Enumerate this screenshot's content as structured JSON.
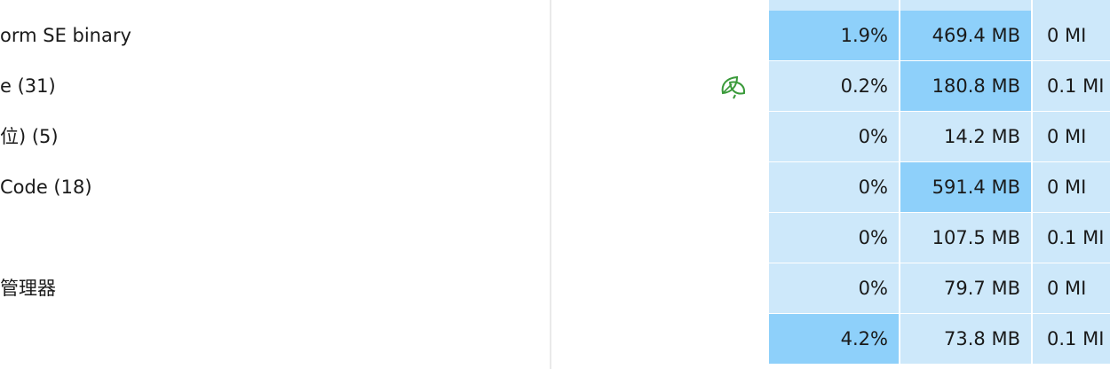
{
  "colors": {
    "heat_low": "#cde8fa",
    "heat_mid": "#8ed0fa",
    "eco_icon": "#3a9a3a"
  },
  "processes": [
    {
      "name": "orm SE binary",
      "cpu": "1.9%",
      "memory": "469.4 MB",
      "disk": "0 MI",
      "cpu_level": "mid",
      "mem_level": "mid",
      "disk_level": "low",
      "eco": false
    },
    {
      "name": "e (31)",
      "cpu": "0.2%",
      "memory": "180.8 MB",
      "disk": "0.1 MI",
      "cpu_level": "low",
      "mem_level": "mid",
      "disk_level": "low",
      "eco": true,
      "status_icon": "leaf-icon"
    },
    {
      "name": "位) (5)",
      "cpu": "0%",
      "memory": "14.2 MB",
      "disk": "0 MI",
      "cpu_level": "low",
      "mem_level": "low",
      "disk_level": "low",
      "eco": false
    },
    {
      "name": "Code (18)",
      "cpu": "0%",
      "memory": "591.4 MB",
      "disk": "0 MI",
      "cpu_level": "low",
      "mem_level": "mid",
      "disk_level": "low",
      "eco": false
    },
    {
      "name": "",
      "cpu": "0%",
      "memory": "107.5 MB",
      "disk": "0.1 MI",
      "cpu_level": "low",
      "mem_level": "low",
      "disk_level": "low",
      "eco": false
    },
    {
      "name": "管理器",
      "cpu": "0%",
      "memory": "79.7 MB",
      "disk": "0 MI",
      "cpu_level": "low",
      "mem_level": "low",
      "disk_level": "low",
      "eco": false
    },
    {
      "name": "",
      "cpu": "4.2%",
      "memory": "73.8 MB",
      "disk": "0.1 MI",
      "cpu_level": "mid",
      "mem_level": "low",
      "disk_level": "low",
      "eco": false
    }
  ]
}
